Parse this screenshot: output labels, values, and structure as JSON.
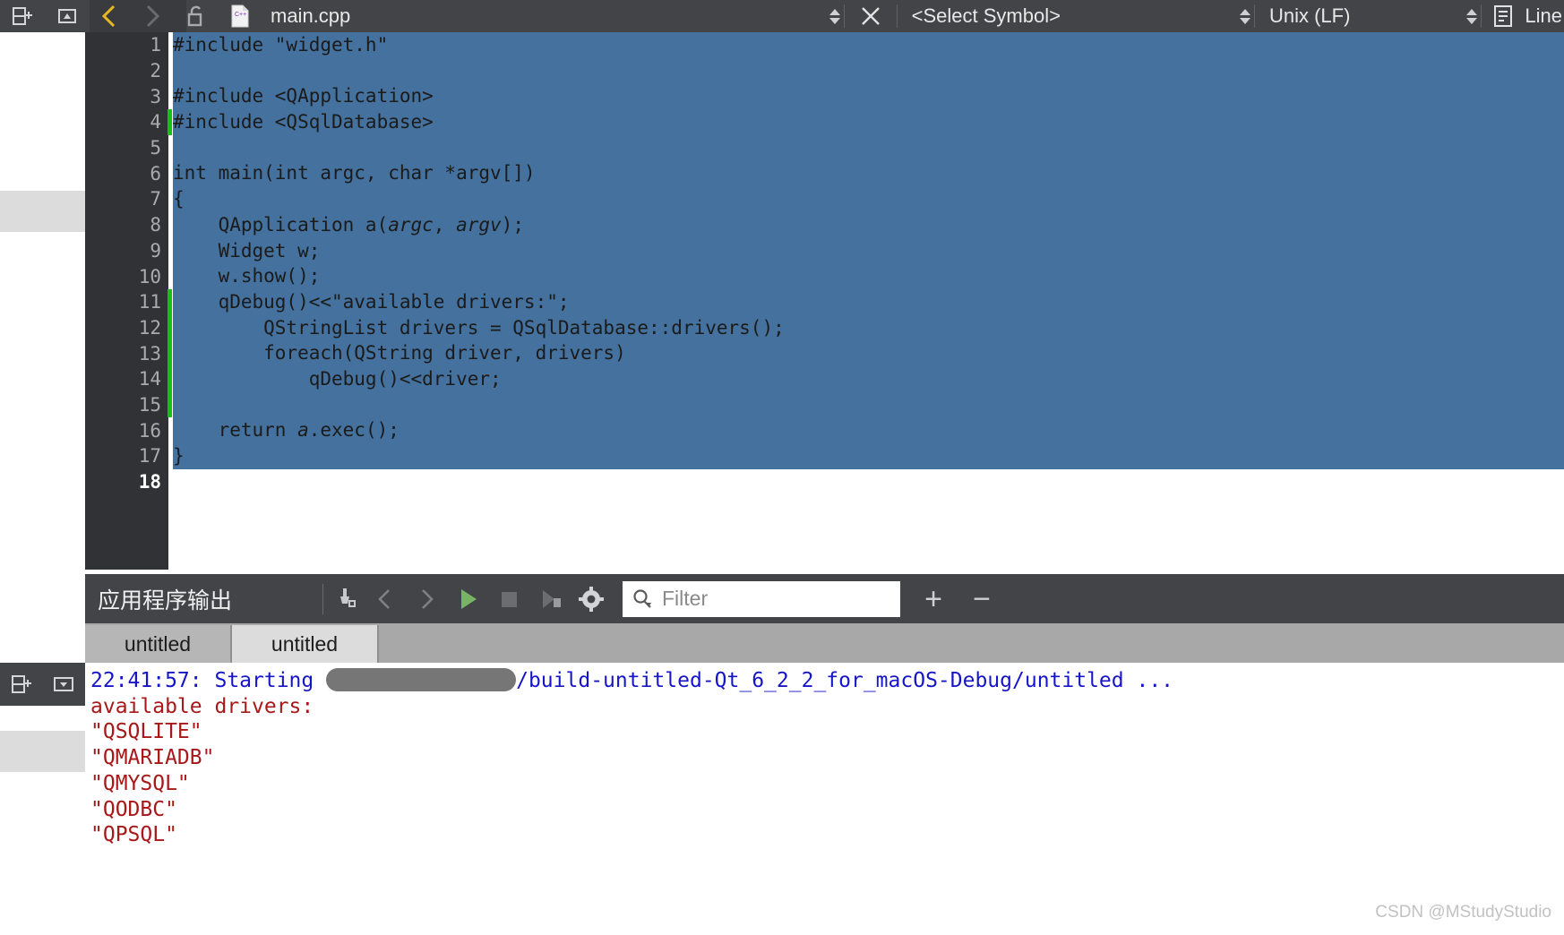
{
  "toolbar": {
    "split_icon": "split-pane-icon",
    "collapse_icon": "collapse-pane-icon",
    "back_icon": "navigate-back-icon",
    "forward_icon": "navigate-forward-icon",
    "lock_icon": "unlocked-file-icon",
    "filetype_icon": "cpp-file-icon",
    "filetype_badge": "C++",
    "filename": "main.cpp",
    "file_spinner_icon": "file-spinner-icon",
    "close_icon": "close-document-icon",
    "symbol_selector": "<Select Symbol>",
    "symbol_spinner_icon": "symbol-spinner-icon",
    "line_ending": "Unix (LF)",
    "line_ending_spinner_icon": "line-ending-spinner-icon",
    "line_wrap_icon": "line-wrap-icon",
    "line_wrap_label": "Line"
  },
  "editor": {
    "lines": [
      {
        "num": "1",
        "text": "#include \"widget.h\"",
        "modified": false,
        "fold": false,
        "current": false
      },
      {
        "num": "2",
        "text": "",
        "modified": false,
        "fold": false,
        "current": false
      },
      {
        "num": "3",
        "text": "#include <QApplication>",
        "modified": false,
        "fold": false,
        "current": false
      },
      {
        "num": "4",
        "text": "#include <QSqlDatabase>",
        "modified": true,
        "fold": false,
        "current": false
      },
      {
        "num": "5",
        "text": "",
        "modified": false,
        "fold": false,
        "current": false
      },
      {
        "num": "6",
        "text": "int main(int argc, char *argv[])",
        "modified": false,
        "fold": true,
        "current": false
      },
      {
        "num": "7",
        "text": "{",
        "modified": false,
        "fold": false,
        "current": false
      },
      {
        "num": "8",
        "text": "    QApplication a(argc, argv);",
        "modified": false,
        "fold": false,
        "current": false
      },
      {
        "num": "9",
        "text": "    Widget w;",
        "modified": false,
        "fold": false,
        "current": false
      },
      {
        "num": "10",
        "text": "    w.show();",
        "modified": false,
        "fold": false,
        "current": false
      },
      {
        "num": "11",
        "text": "    qDebug()<<\"available drivers:\";",
        "modified": true,
        "fold": false,
        "current": false
      },
      {
        "num": "12",
        "text": "        QStringList drivers = QSqlDatabase::drivers();",
        "modified": true,
        "fold": false,
        "current": false
      },
      {
        "num": "13",
        "text": "        foreach(QString driver, drivers)",
        "modified": true,
        "fold": false,
        "current": false
      },
      {
        "num": "14",
        "text": "            qDebug()<<driver;",
        "modified": true,
        "fold": false,
        "current": false
      },
      {
        "num": "15",
        "text": "",
        "modified": true,
        "fold": false,
        "current": false
      },
      {
        "num": "16",
        "text": "    return a.exec();",
        "modified": false,
        "fold": false,
        "current": false
      },
      {
        "num": "17",
        "text": "}",
        "modified": false,
        "fold": false,
        "current": false
      },
      {
        "num": "18",
        "text": "",
        "modified": false,
        "fold": false,
        "current": true
      }
    ],
    "selection_color": "#44719d",
    "gutter_color": "#313235",
    "modified_marker_color": "#17c017"
  },
  "output": {
    "title": "应用程序输出",
    "icons": {
      "clear": "clear-output-icon",
      "prev": "previous-item-icon",
      "next": "next-item-icon",
      "run": "run-icon",
      "stop": "stop-icon",
      "rerun_debug": "rerun-debug-icon",
      "settings": "gear-icon",
      "search": "search-icon",
      "add": "add-pane-icon",
      "remove": "remove-pane-icon"
    },
    "run_color": "#79b464",
    "filter_placeholder": "Filter",
    "filter_value": "",
    "add_label": "+",
    "remove_label": "−",
    "tabs": [
      {
        "label": "untitled",
        "active": false
      },
      {
        "label": "untitled",
        "active": true
      }
    ],
    "console_lines": [
      {
        "kind": "start",
        "color": "blue",
        "prefix": "22:41:57: Starting ",
        "redacted": true,
        "suffix": "/build-untitled-Qt_6_2_2_for_macOS-Debug/untitled ..."
      },
      {
        "kind": "text",
        "color": "red",
        "text": "available drivers:"
      },
      {
        "kind": "text",
        "color": "red",
        "text": "\"QSQLITE\""
      },
      {
        "kind": "text",
        "color": "red",
        "text": "\"QMARIADB\""
      },
      {
        "kind": "text",
        "color": "red",
        "text": "\"QMYSQL\""
      },
      {
        "kind": "text",
        "color": "red",
        "text": "\"QODBC\""
      },
      {
        "kind": "text",
        "color": "red",
        "text": "\"QPSQL\""
      }
    ],
    "start_color": "#1616c8",
    "driver_color": "#a81818"
  },
  "bottom_rail": {
    "split_icon": "split-pane-icon",
    "collapse_icon": "collapse-pane-icon"
  },
  "watermark": "CSDN @MStudyStudio"
}
